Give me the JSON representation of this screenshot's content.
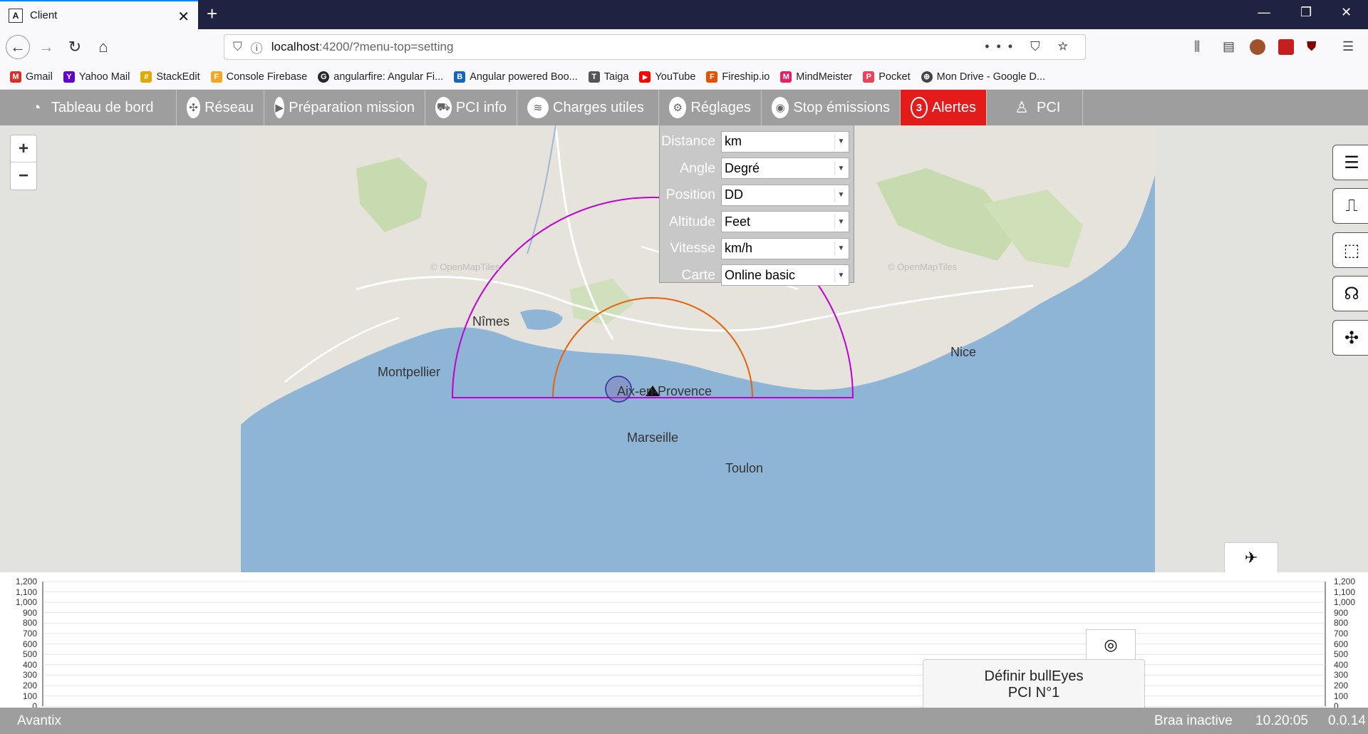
{
  "browser": {
    "tab_title": "Client",
    "url_host": "localhost",
    "url_path": ":4200/?menu-top=setting"
  },
  "bookmarks": [
    {
      "label": "Gmail",
      "color": "#d93025",
      "icon": "M"
    },
    {
      "label": "Yahoo Mail",
      "color": "#6001d2",
      "icon": "Y"
    },
    {
      "label": "StackEdit",
      "color": "#e0a800",
      "icon": "#"
    },
    {
      "label": "Console Firebase",
      "color": "#f5a623",
      "icon": "F"
    },
    {
      "label": "angularfire: Angular Fi...",
      "color": "#24292e",
      "icon": "G"
    },
    {
      "label": "Angular powered Boo...",
      "color": "#1565c0",
      "icon": "B"
    },
    {
      "label": "Taiga",
      "color": "#555555",
      "icon": "T"
    },
    {
      "label": "YouTube",
      "color": "#ff0000",
      "icon": "▶"
    },
    {
      "label": "Fireship.io",
      "color": "#e65100",
      "icon": "F"
    },
    {
      "label": "MindMeister",
      "color": "#e91e63",
      "icon": "M"
    },
    {
      "label": "Pocket",
      "color": "#ef4056",
      "icon": "P"
    },
    {
      "label": "Mon Drive - Google D...",
      "color": "#444444",
      "icon": "⊕"
    }
  ],
  "menu": [
    {
      "label": "Tableau de bord",
      "icon": "◔"
    },
    {
      "label": "Réseau",
      "icon": "✣"
    },
    {
      "label": "Préparation mission",
      "icon": "▶"
    },
    {
      "label": "PCI info",
      "icon": "⛟"
    },
    {
      "label": "Charges utiles",
      "icon": "≋"
    },
    {
      "label": "Réglages",
      "icon": "⚙"
    },
    {
      "label": "Stop émissions",
      "icon": "◉"
    },
    {
      "label": "Alertes",
      "icon": "3"
    },
    {
      "label": "PCI",
      "icon": "♙"
    }
  ],
  "settings": {
    "rows": [
      {
        "label": "Distance",
        "value": "km"
      },
      {
        "label": "Angle",
        "value": "Degré"
      },
      {
        "label": "Position",
        "value": "DD"
      },
      {
        "label": "Altitude",
        "value": "Feet"
      },
      {
        "label": "Vitesse",
        "value": "km/h"
      },
      {
        "label": "Carte",
        "value": "Online basic"
      }
    ]
  },
  "map": {
    "cities": [
      {
        "name": "Nîmes"
      },
      {
        "name": "Montpellier"
      },
      {
        "name": "Aix-en-Provence"
      },
      {
        "name": "Marseille"
      },
      {
        "name": "Toulon"
      },
      {
        "name": "Nice"
      }
    ],
    "attribution": "© OpenMapTiles",
    "colors": {
      "sea": "#8fb5d6",
      "outer_arc": "#c000d0",
      "inner_arc": "#e8620b"
    }
  },
  "profile": {
    "y_ticks": [
      "1,200",
      "1,100",
      "1,000",
      "900",
      "800",
      "700",
      "600",
      "500",
      "400",
      "300",
      "200",
      "100",
      "0"
    ]
  },
  "bullseye": {
    "line1": "Définir bullEyes",
    "line2": "PCI N°1"
  },
  "status": {
    "app_name": "Avantix",
    "braa": "Braa inactive",
    "time": "10.20:05",
    "version": "0.0.14"
  }
}
